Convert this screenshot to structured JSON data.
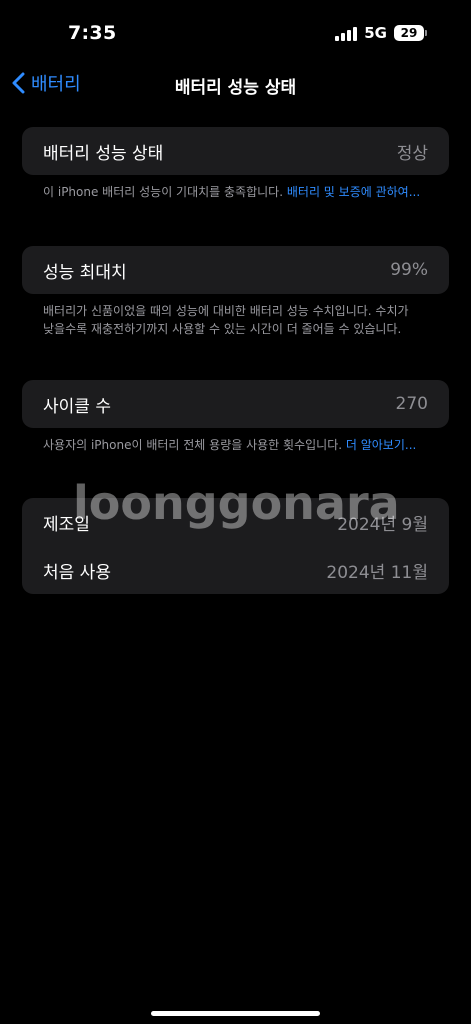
{
  "status_bar": {
    "time": "7:35",
    "network": "5G",
    "battery_level": "29"
  },
  "nav": {
    "back_label": "배터리",
    "title": "배터리 성능 상태"
  },
  "health_card": {
    "label": "배터리 성능 상태",
    "value": "정상"
  },
  "health_note": {
    "text": "이 iPhone 배터리 성능이 기대치를 충족합니다. ",
    "link": "배터리 및 보증에 관하여..."
  },
  "capacity_card": {
    "label": "성능 최대치",
    "value": "99%"
  },
  "capacity_note": {
    "text": "배터리가 신품이었을 때의 성능에 대비한 배터리 성능 수치입니다. 수치가 낮을수록 재충전하기까지 사용할 수 있는 시간이 더 줄어들 수 있습니다."
  },
  "cycle_card": {
    "label": "사이클 수",
    "value": "270"
  },
  "cycle_note": {
    "text": "사용자의 iPhone이 배터리 전체 용량을 사용한 횟수입니다. ",
    "link": "더 알아보기..."
  },
  "dates_card": {
    "manufactured_label": "제조일",
    "manufactured_value": "2024년 9월",
    "first_use_label": "처음 사용",
    "first_use_value": "2024년 11월"
  },
  "watermark": "loonggonara",
  "colors": {
    "background": "#000000",
    "card": "#1c1c1e",
    "accent": "#2f8cff",
    "secondary_text": "#8e8e93"
  }
}
